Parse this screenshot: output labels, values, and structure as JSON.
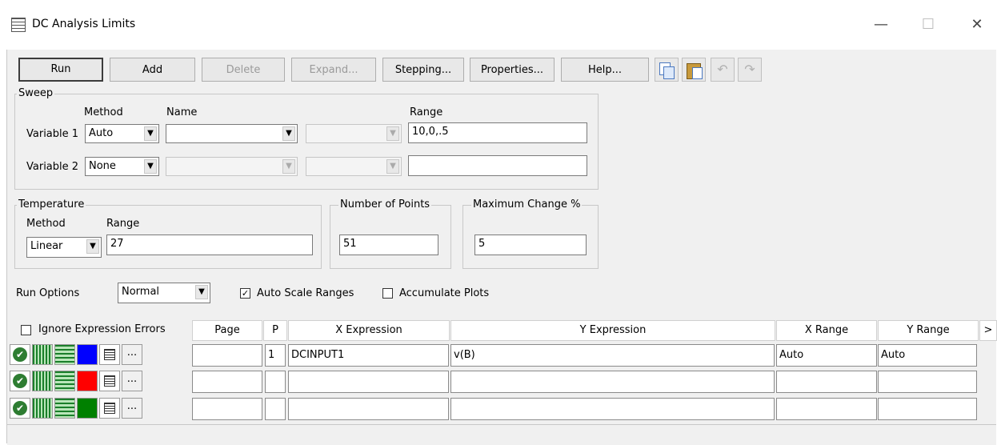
{
  "window": {
    "title": "DC Analysis Limits",
    "controls": {
      "minimize": "—",
      "maximize": "☐",
      "close": "✕"
    }
  },
  "toolbar": {
    "buttons": [
      "Run",
      "Add",
      "Delete",
      "Expand...",
      "Stepping...",
      "Properties...",
      "Help..."
    ],
    "icons": [
      "copy-icon",
      "paste-icon",
      "undo-icon",
      "redo-icon"
    ]
  },
  "sweep": {
    "label": "Sweep",
    "col_method": "Method",
    "col_name": "Name",
    "col_range": "Range",
    "var1": {
      "label": "Variable 1",
      "method": "Auto",
      "name": "",
      "range": "10,0,.5"
    },
    "var2": {
      "label": "Variable 2",
      "method": "None",
      "name": "",
      "range": ""
    }
  },
  "temperature": {
    "label": "Temperature",
    "method_label": "Method",
    "range_label": "Range",
    "method": "Linear",
    "range": "27"
  },
  "points": {
    "label": "Number of Points",
    "value": "51"
  },
  "maxchange": {
    "label": "Maximum Change %",
    "value": "5"
  },
  "run_options": {
    "label": "Run Options",
    "value": "Normal",
    "auto_scale_label": "Auto Scale Ranges",
    "auto_scale_checked": true,
    "accumulate_label": "Accumulate Plots",
    "accumulate_checked": false
  },
  "table": {
    "ignore_errors_label": "Ignore Expression Errors",
    "headers": {
      "page": "Page",
      "p": "P",
      "x": "X Expression",
      "y": "Y Expression",
      "xr": "X Range",
      "yr": "Y Range",
      "more": ">"
    },
    "rows": [
      {
        "color": "#0000ff",
        "page": "",
        "p": "1",
        "x": "DCINPUT1",
        "y": "v(B)",
        "xr": "Auto",
        "yr": "Auto"
      },
      {
        "color": "#ff0000",
        "page": "",
        "p": "",
        "x": "",
        "y": "",
        "xr": "",
        "yr": ""
      },
      {
        "color": "#008000",
        "page": "",
        "p": "",
        "x": "",
        "y": "",
        "xr": "",
        "yr": ""
      }
    ],
    "more_label": "..."
  }
}
